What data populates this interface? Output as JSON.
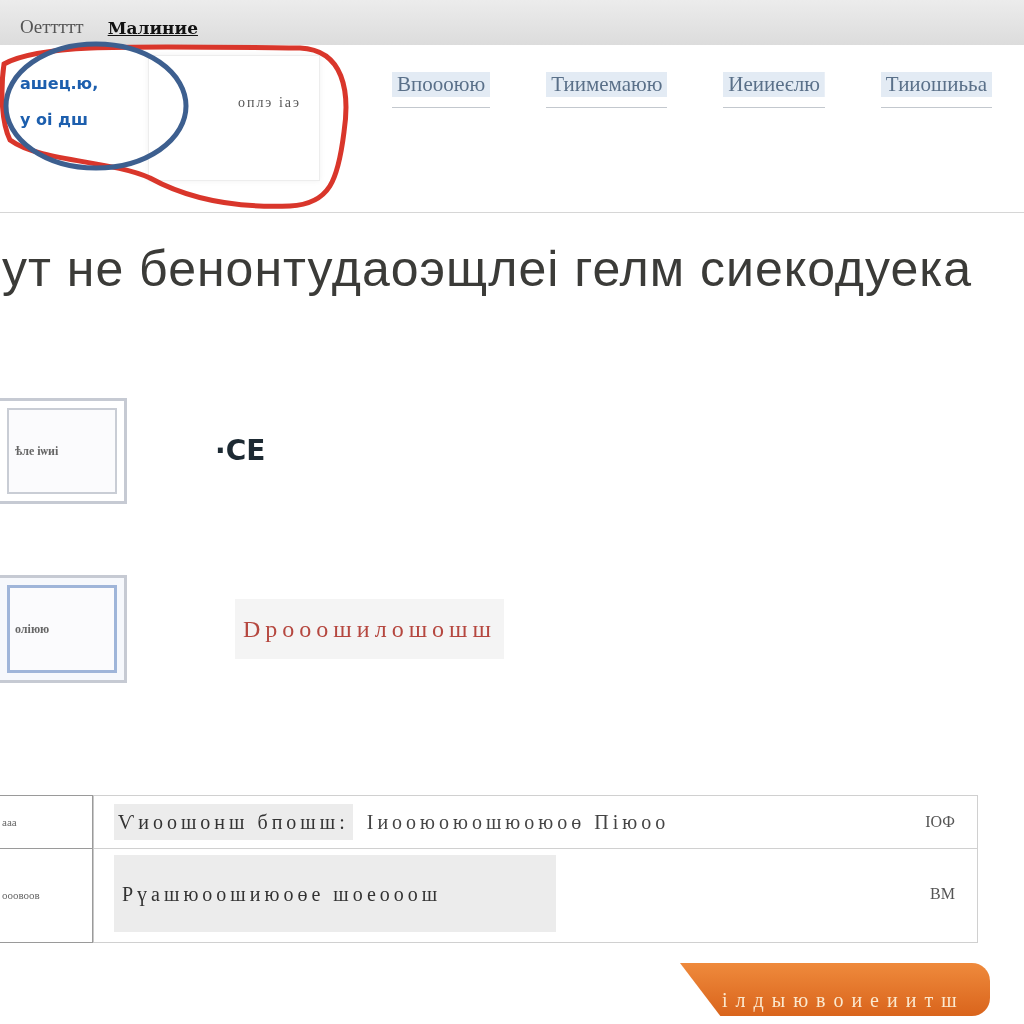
{
  "top_bar": {
    "title": "Оеттттт",
    "menu_item": "Малиние"
  },
  "header": {
    "links": [
      "ашец.ю,",
      "у оі дш"
    ],
    "panel_text": "оплэ іаэ"
  },
  "annotations": [
    {
      "kind": "loop",
      "color": "#d9362b"
    },
    {
      "kind": "ellipse",
      "color": "#3d5f8f"
    }
  ],
  "nav": [
    {
      "label": "Впоооюю",
      "selected": false
    },
    {
      "label": "Тиимемаюю",
      "selected": false
    },
    {
      "label": "Иеииеєлю",
      "selected": false
    },
    {
      "label": "Тииошиььа",
      "selected": false
    }
  ],
  "headline": "ут не бенонтудаоэщлеі гелм сиекодуека",
  "form_rows": [
    {
      "value": "ѣле іѡиі",
      "focused": false,
      "label": "·СЕ",
      "kind": "plain"
    },
    {
      "value": "оліюю",
      "focused": true,
      "label": "Dрооошилошошш",
      "kind": "alert"
    }
  ],
  "table": {
    "rows": [
      {
        "key": "ааа",
        "label": "Ѵиоошонш бпошш:",
        "text": "Іиооюоюошюоюоө Піюоо",
        "value": "ІОФ"
      },
      {
        "key": "ооовоов",
        "label": "Рүашюоошиюоөе шоеооош",
        "value": "ВМ"
      }
    ]
  },
  "button": {
    "label": "ілдыювоиеиитш"
  }
}
